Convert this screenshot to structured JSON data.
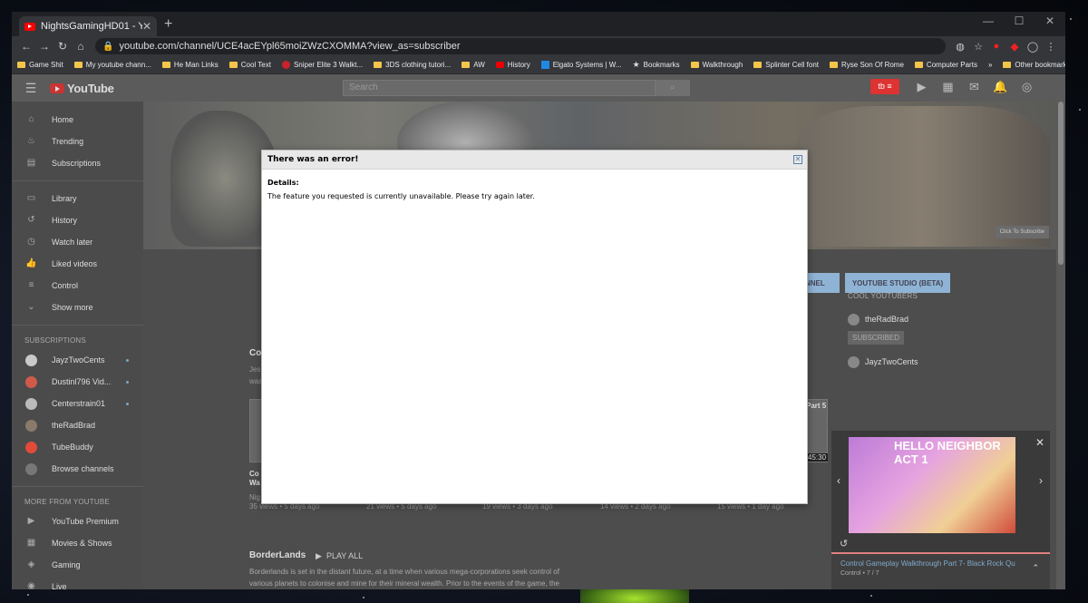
{
  "browser": {
    "tab_title": "NightsGamingHD01 - YouTube",
    "url": "youtube.com/channel/UCE4acEYpl65moiZWzCXOMMA?view_as=subscriber",
    "bookmarks": [
      {
        "label": "Game Shit",
        "icon": "folder"
      },
      {
        "label": "My youtube chann...",
        "icon": "folder"
      },
      {
        "label": "He Man Links",
        "icon": "folder"
      },
      {
        "label": "Cool Text",
        "icon": "folder"
      },
      {
        "label": "Sniper Elite 3 Walkt...",
        "icon": "p"
      },
      {
        "label": "3DS clothing tutori...",
        "icon": "folder"
      },
      {
        "label": "AW",
        "icon": "folder"
      },
      {
        "label": "History",
        "icon": "yt"
      },
      {
        "label": "Elgato Systems | W...",
        "icon": "d"
      },
      {
        "label": "Bookmarks",
        "icon": "star"
      },
      {
        "label": "Walkthrough",
        "icon": "folder"
      },
      {
        "label": "Splinter Cell font",
        "icon": "folder"
      },
      {
        "label": "Ryse Son Of Rome",
        "icon": "folder"
      },
      {
        "label": "Computer Parts",
        "icon": "folder"
      }
    ],
    "bookmarks_overflow": "»",
    "other_bookmarks": "Other bookmarks"
  },
  "youtube": {
    "logo_text": "YouTube",
    "search_placeholder": "Search",
    "sidebar_main": [
      {
        "label": "Home",
        "icon": "home-icon",
        "glyph": "⌂"
      },
      {
        "label": "Trending",
        "icon": "trending-icon",
        "glyph": "♨"
      },
      {
        "label": "Subscriptions",
        "icon": "subscriptions-icon",
        "glyph": "▤"
      }
    ],
    "sidebar_library": [
      {
        "label": "Library",
        "icon": "library-icon",
        "glyph": "▭"
      },
      {
        "label": "History",
        "icon": "history-icon",
        "glyph": "↺"
      },
      {
        "label": "Watch later",
        "icon": "watch-later-icon",
        "glyph": "◷"
      },
      {
        "label": "Liked videos",
        "icon": "liked-icon",
        "glyph": "👍"
      },
      {
        "label": "Control",
        "icon": "playlist-icon",
        "glyph": "≡"
      },
      {
        "label": "Show more",
        "icon": "chevron-down-icon",
        "glyph": "⌄"
      }
    ],
    "subscriptions_heading": "SUBSCRIPTIONS",
    "subscriptions": [
      {
        "label": "JayzTwoCents",
        "color": "#c9c9c9",
        "dot": true
      },
      {
        "label": "Dustinl796 Vid...",
        "color": "#d05a4a",
        "dot": true
      },
      {
        "label": "Centerstrain01",
        "color": "#bbbbbb",
        "dot": true
      },
      {
        "label": "theRadBrad",
        "color": "#8a7a6a",
        "dot": false
      },
      {
        "label": "TubeBuddy",
        "color": "#e24a3a",
        "dot": false
      },
      {
        "label": "Browse channels",
        "color": "#777777",
        "dot": false
      }
    ],
    "more_heading": "MORE FROM YOUTUBE",
    "more": [
      {
        "label": "YouTube Premium",
        "icon": "youtube-premium-icon",
        "glyph": "▶"
      },
      {
        "label": "Movies & Shows",
        "icon": "movies-icon",
        "glyph": "▦"
      },
      {
        "label": "Gaming",
        "icon": "gaming-icon",
        "glyph": "◈"
      },
      {
        "label": "Live",
        "icon": "live-icon",
        "glyph": "◉"
      }
    ],
    "banner_watermark": "Click To Subscribe",
    "channel_button_partial": "ANNEL",
    "studio_button": "YOUTUBE STUDIO (BETA)",
    "section_title_partial": "Co",
    "section_desc_line1": "Jes",
    "section_desc_line2": "was",
    "video_title_partial_1": "Co",
    "video_title_partial_2": "Wa",
    "video_channel_partial": "Nig",
    "video_stats": [
      "35 views • 5 days ago",
      "21 views • 5 days ago",
      "19 views • 3 days ago",
      "14 views • 2 days ago",
      "15 views • 1 day ago"
    ],
    "part5_label": "Part 5",
    "duration": "45:30",
    "borderlands_title": "BorderLands",
    "play_all": "PLAY ALL",
    "borderlands_desc1": "Borderlands is set in the distant future, at a time when various mega-corporations seek control of",
    "borderlands_desc2": "various planets to colonise and mine for their mineral wealth. Prior to the events of the game, the",
    "cool_heading": "COOL YOUTUBERS",
    "cool_1": "theRadBrad",
    "subscribed": "SUBSCRIBED",
    "cool_2": "JayzTwoCents",
    "miniplayer": {
      "overlay_text": "HELLO NEIGHBOR ACT 1",
      "title": "Control Gameplay Walkthrough Part 7- Black Rock Qu",
      "sub": "Control • 7 / 7"
    }
  },
  "dialog": {
    "title": "There was an error!",
    "details_label": "Details:",
    "message": "The feature you requested is currently unavailable. Please try again later.",
    "close_glyph": "✕"
  }
}
